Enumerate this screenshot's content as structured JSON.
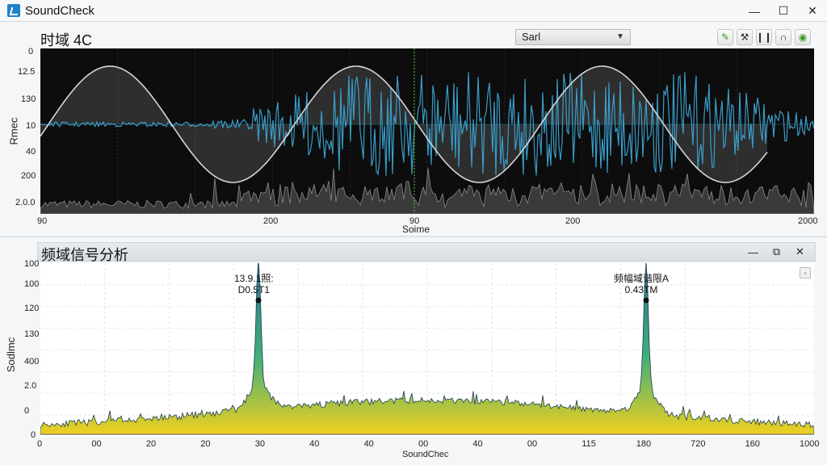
{
  "app": {
    "title": "SoundCheck",
    "icon": "soundcheck-logo-icon"
  },
  "window_controls": {
    "minimize": "—",
    "maximize": "☐",
    "close": "✕"
  },
  "top_panel": {
    "title": "时域 4C",
    "select_value": "Sarl",
    "toolbar": [
      {
        "name": "tool-leaf-icon",
        "glyph": "✎"
      },
      {
        "name": "tool-wrench-icon",
        "glyph": "⚒"
      },
      {
        "name": "tool-pause-icon",
        "glyph": "❙❙"
      },
      {
        "name": "tool-arch-icon",
        "glyph": "∩"
      },
      {
        "name": "tool-refresh-icon",
        "glyph": "◉"
      }
    ],
    "ylabel": "Rmec",
    "xlabel": "Soime",
    "yticks": [
      "0",
      "12.5",
      "130",
      "10",
      "40",
      "200",
      "2.0.0"
    ],
    "xticks": [
      "90",
      "200",
      "90",
      "200",
      "2000"
    ]
  },
  "bottom_panel": {
    "title": "频域信号分析",
    "controls": {
      "minimize": "—",
      "restore": "⧉",
      "close": "✕"
    },
    "ylabel": "Sodlmc",
    "xlabel": "SoundChec",
    "yticks": [
      "0",
      "100",
      "100",
      "120",
      "130",
      "400",
      "2.0",
      "0"
    ],
    "xticks": [
      "0",
      "00",
      "20",
      "20",
      "30",
      "40",
      "40",
      "00",
      "40",
      "00",
      "115",
      "180",
      "720",
      "160",
      "1000"
    ],
    "peak_left": {
      "line1": "13.9.1照:",
      "line2": "D0.5T1"
    },
    "peak_right": {
      "line1": "频幅域谐限A",
      "line2": "0.43TM"
    }
  },
  "colors": {
    "plot_bg": "#0d0d0d",
    "waveform": "#3a9cc8",
    "sine": "#d6d6d6",
    "marker": "#5fc84a",
    "spectrum_top": "#2f6f8f",
    "spectrum_mid": "#3fae7a",
    "spectrum_base": "#f0d020"
  }
}
